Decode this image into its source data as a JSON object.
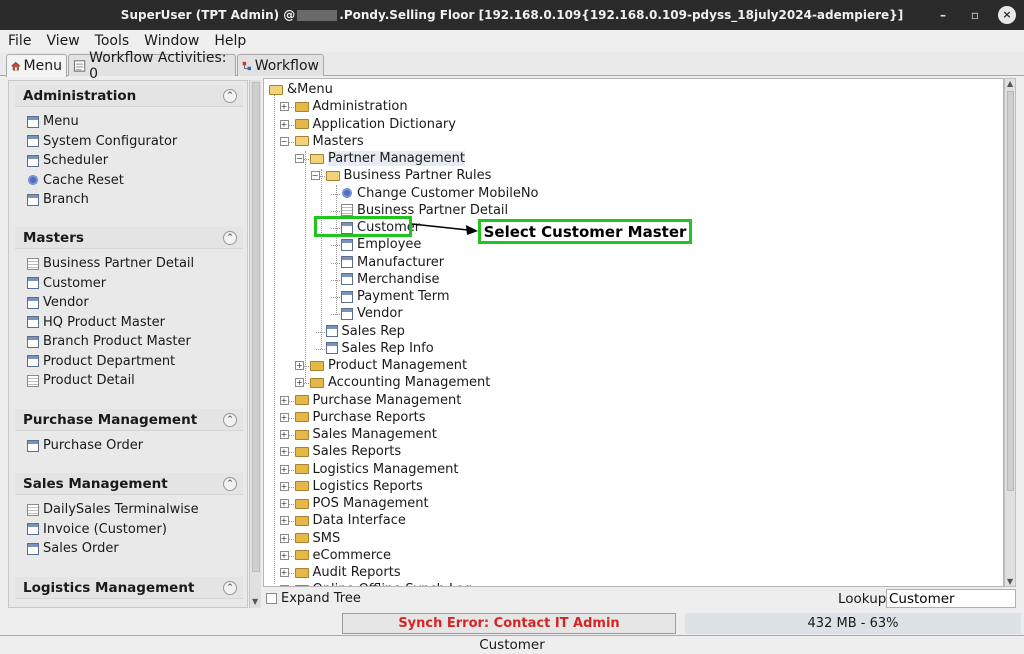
{
  "window": {
    "title_prefix": "SuperUser (TPT Admin) @",
    "title_suffix": ".Pondy.Selling Floor [192.168.0.109{192.168.0.109-pdyss_18july2024-adempiere}]",
    "min_glyph": "–",
    "max_glyph": "▫",
    "close_glyph": "×"
  },
  "menubar": [
    "File",
    "View",
    "Tools",
    "Window",
    "Help"
  ],
  "tabs": [
    {
      "label": "Menu",
      "active": true,
      "icon": "home-icon"
    },
    {
      "label": "Workflow Activities: 0",
      "active": false,
      "icon": "workflow-activities-icon"
    },
    {
      "label": "Workflow",
      "active": false,
      "icon": "workflow-icon"
    }
  ],
  "sidebar": {
    "collapse_glyph": "⌃",
    "sections": [
      {
        "title": "Administration",
        "items": [
          {
            "label": "Menu",
            "icon": "window"
          },
          {
            "label": "System Configurator",
            "icon": "window"
          },
          {
            "label": "Scheduler",
            "icon": "window"
          },
          {
            "label": "Cache Reset",
            "icon": "process"
          },
          {
            "label": "Branch",
            "icon": "window"
          }
        ]
      },
      {
        "title": "Masters",
        "items": [
          {
            "label": "Business Partner Detail",
            "icon": "report"
          },
          {
            "label": "Customer",
            "icon": "window"
          },
          {
            "label": "Vendor",
            "icon": "window"
          },
          {
            "label": "HQ Product Master",
            "icon": "window"
          },
          {
            "label": "Branch Product Master",
            "icon": "window"
          },
          {
            "label": "Product Department",
            "icon": "window"
          },
          {
            "label": "Product Detail",
            "icon": "report"
          }
        ]
      },
      {
        "title": "Purchase Management",
        "items": [
          {
            "label": "Purchase Order",
            "icon": "window"
          }
        ]
      },
      {
        "title": "Sales Management",
        "items": [
          {
            "label": "DailySales Terminalwise",
            "icon": "report"
          },
          {
            "label": "Invoice (Customer)",
            "icon": "window"
          },
          {
            "label": "Sales Order",
            "icon": "window"
          }
        ]
      },
      {
        "title": "Logistics Management",
        "items": []
      }
    ]
  },
  "tree": {
    "root": "&Menu",
    "nodes": [
      {
        "label": "Administration",
        "level": 1,
        "type": "folder",
        "expander": "+"
      },
      {
        "label": "Application Dictionary",
        "level": 1,
        "type": "folder",
        "expander": "+"
      },
      {
        "label": "Masters",
        "level": 1,
        "type": "folder-open",
        "expander": "−"
      },
      {
        "label": "Partner Management",
        "level": 2,
        "type": "folder-open",
        "expander": "−",
        "selected": true
      },
      {
        "label": "Business Partner Rules",
        "level": 3,
        "type": "folder-open",
        "expander": "−"
      },
      {
        "label": "Change Customer MobileNo",
        "level": 4,
        "type": "process"
      },
      {
        "label": "Business Partner Detail",
        "level": 4,
        "type": "report"
      },
      {
        "label": "Customer",
        "level": 4,
        "type": "window"
      },
      {
        "label": "Employee",
        "level": 4,
        "type": "window"
      },
      {
        "label": "Manufacturer",
        "level": 4,
        "type": "window"
      },
      {
        "label": "Merchandise",
        "level": 4,
        "type": "window"
      },
      {
        "label": "Payment Term",
        "level": 4,
        "type": "window"
      },
      {
        "label": "Vendor",
        "level": 4,
        "type": "window"
      },
      {
        "label": "Sales Rep",
        "level": 3,
        "type": "window"
      },
      {
        "label": "Sales Rep Info",
        "level": 3,
        "type": "window"
      },
      {
        "label": "Product Management",
        "level": 2,
        "type": "folder",
        "expander": "+"
      },
      {
        "label": "Accounting Management",
        "level": 2,
        "type": "folder",
        "expander": "+"
      },
      {
        "label": "Purchase Management",
        "level": 1,
        "type": "folder",
        "expander": "+"
      },
      {
        "label": "Purchase Reports",
        "level": 1,
        "type": "folder",
        "expander": "+"
      },
      {
        "label": "Sales Management",
        "level": 1,
        "type": "folder",
        "expander": "+"
      },
      {
        "label": "Sales Reports",
        "level": 1,
        "type": "folder",
        "expander": "+"
      },
      {
        "label": "Logistics Management",
        "level": 1,
        "type": "folder",
        "expander": "+"
      },
      {
        "label": "Logistics Reports",
        "level": 1,
        "type": "folder",
        "expander": "+"
      },
      {
        "label": "POS Management",
        "level": 1,
        "type": "folder",
        "expander": "+"
      },
      {
        "label": "Data Interface",
        "level": 1,
        "type": "folder",
        "expander": "+"
      },
      {
        "label": "SMS",
        "level": 1,
        "type": "folder",
        "expander": "+"
      },
      {
        "label": "eCommerce",
        "level": 1,
        "type": "folder",
        "expander": "+"
      },
      {
        "label": "Audit Reports",
        "level": 1,
        "type": "folder",
        "expander": "+"
      },
      {
        "label": "Online Offline Synch Log",
        "level": 1,
        "type": "folder",
        "expander": "+"
      }
    ]
  },
  "annotation": {
    "callout": "Select Customer Master"
  },
  "footer": {
    "expand_tree": "Expand Tree",
    "lookup_label": "Lookup",
    "lookup_value": "Customer"
  },
  "status": {
    "synch_error": "Synch Error: Contact IT Admin",
    "memory": "432 MB - 63%",
    "bottom": "Customer"
  },
  "colors": {
    "highlight": "#22c51f",
    "error": "#d62424",
    "titlebar": "#2b2b2b"
  }
}
